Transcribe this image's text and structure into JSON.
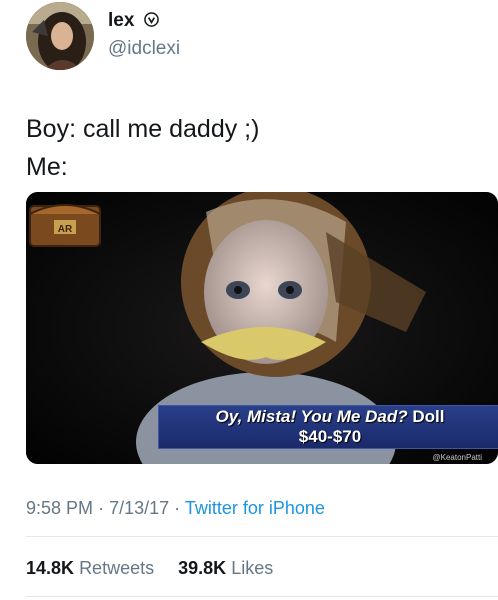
{
  "user": {
    "name": "lex",
    "handle": "@idclexi"
  },
  "tweet": {
    "line1": "Boy: call me daddy ;)",
    "line2": "Me:"
  },
  "media": {
    "caption_main": "Oy, Mista! You Me Dad?",
    "caption_tag": "Doll",
    "caption_price": "$40-$70",
    "logo_text": "AR",
    "watermark": "@KeatonPatti"
  },
  "meta": {
    "time": "9:58 PM",
    "date": "7/13/17",
    "source": "Twitter for iPhone",
    "separator": "·"
  },
  "stats": {
    "retweets_count": "14.8K",
    "retweets_label": "Retweets",
    "likes_count": "39.8K",
    "likes_label": "Likes"
  },
  "colors": {
    "text": "#14171a",
    "muted": "#657786",
    "link": "#1b95e0",
    "banner": "#1a2a6b"
  }
}
